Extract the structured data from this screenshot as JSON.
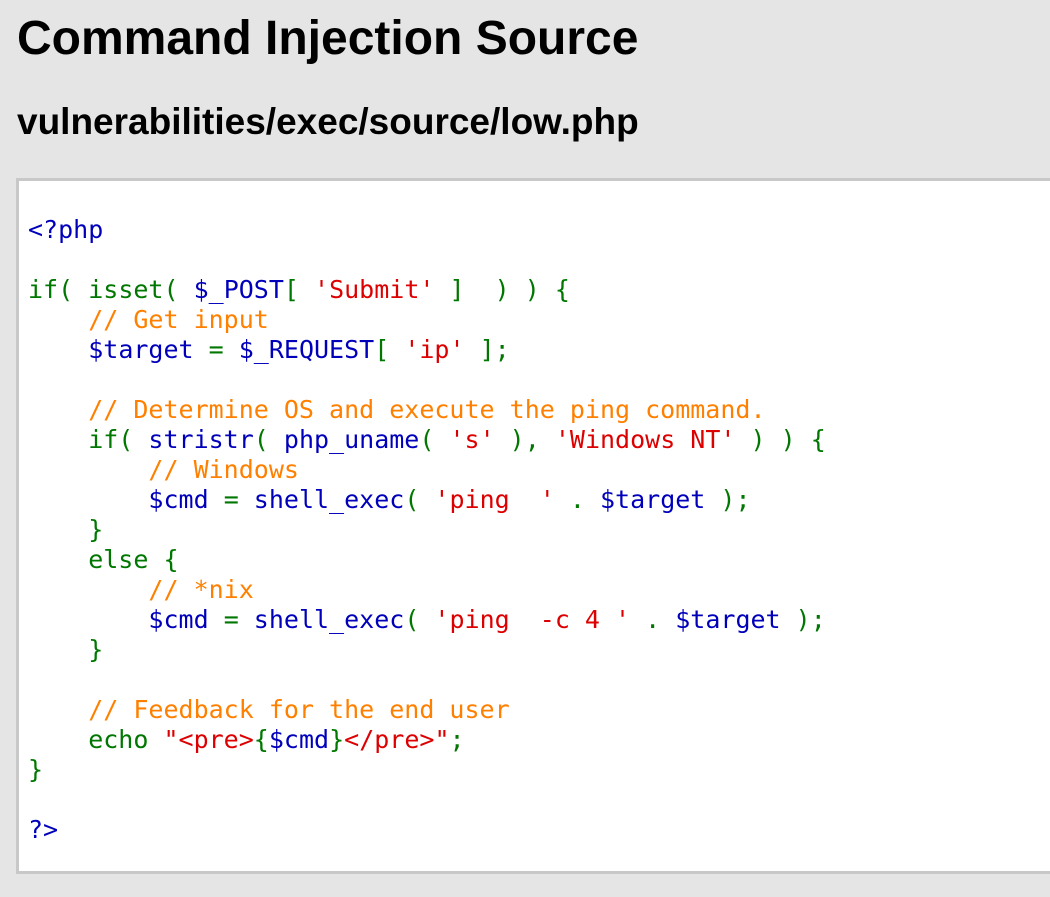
{
  "page": {
    "title": "Command Injection Source",
    "file_path": "vulnerabilities/exec/source/low.php"
  },
  "colors": {
    "background": "#e5e5e5",
    "code_background": "#ffffff",
    "code_border": "#c8c8c8",
    "keyword": "#007700",
    "default": "#0000bb",
    "string": "#dd0000",
    "comment": "#ff8000",
    "php_tag": "#0000bb"
  },
  "code": {
    "lines": [
      [
        {
          "t": "<?php",
          "c": "default"
        }
      ],
      [],
      [
        {
          "t": "if( ",
          "c": "keyword"
        },
        {
          "t": "isset",
          "c": "keyword"
        },
        {
          "t": "( ",
          "c": "keyword"
        },
        {
          "t": "$_POST",
          "c": "default"
        },
        {
          "t": "[ ",
          "c": "keyword"
        },
        {
          "t": "'Submit'",
          "c": "string"
        },
        {
          "t": " ]  ) ) {",
          "c": "keyword"
        }
      ],
      [
        {
          "t": "    // Get input",
          "c": "comment"
        }
      ],
      [
        {
          "t": "    ",
          "c": "keyword"
        },
        {
          "t": "$target ",
          "c": "default"
        },
        {
          "t": "= ",
          "c": "keyword"
        },
        {
          "t": "$_REQUEST",
          "c": "default"
        },
        {
          "t": "[ ",
          "c": "keyword"
        },
        {
          "t": "'ip'",
          "c": "string"
        },
        {
          "t": " ];",
          "c": "keyword"
        }
      ],
      [],
      [
        {
          "t": "    // Determine OS and execute the ping command.",
          "c": "comment"
        }
      ],
      [
        {
          "t": "    if( ",
          "c": "keyword"
        },
        {
          "t": "stristr",
          "c": "default"
        },
        {
          "t": "( ",
          "c": "keyword"
        },
        {
          "t": "php_uname",
          "c": "default"
        },
        {
          "t": "( ",
          "c": "keyword"
        },
        {
          "t": "'s'",
          "c": "string"
        },
        {
          "t": " ), ",
          "c": "keyword"
        },
        {
          "t": "'Windows NT'",
          "c": "string"
        },
        {
          "t": " ) ) {",
          "c": "keyword"
        }
      ],
      [
        {
          "t": "        // Windows",
          "c": "comment"
        }
      ],
      [
        {
          "t": "        ",
          "c": "keyword"
        },
        {
          "t": "$cmd ",
          "c": "default"
        },
        {
          "t": "= ",
          "c": "keyword"
        },
        {
          "t": "shell_exec",
          "c": "default"
        },
        {
          "t": "( ",
          "c": "keyword"
        },
        {
          "t": "'ping  '",
          "c": "string"
        },
        {
          "t": " . ",
          "c": "keyword"
        },
        {
          "t": "$target ",
          "c": "default"
        },
        {
          "t": ");",
          "c": "keyword"
        }
      ],
      [
        {
          "t": "    }",
          "c": "keyword"
        }
      ],
      [
        {
          "t": "    else {",
          "c": "keyword"
        }
      ],
      [
        {
          "t": "        // *nix",
          "c": "comment"
        }
      ],
      [
        {
          "t": "        ",
          "c": "keyword"
        },
        {
          "t": "$cmd ",
          "c": "default"
        },
        {
          "t": "= ",
          "c": "keyword"
        },
        {
          "t": "shell_exec",
          "c": "default"
        },
        {
          "t": "( ",
          "c": "keyword"
        },
        {
          "t": "'ping  -c 4 '",
          "c": "string"
        },
        {
          "t": " . ",
          "c": "keyword"
        },
        {
          "t": "$target ",
          "c": "default"
        },
        {
          "t": ");",
          "c": "keyword"
        }
      ],
      [
        {
          "t": "    }",
          "c": "keyword"
        }
      ],
      [],
      [
        {
          "t": "    // Feedback for the end user",
          "c": "comment"
        }
      ],
      [
        {
          "t": "    echo ",
          "c": "keyword"
        },
        {
          "t": "\"",
          "c": "string"
        },
        {
          "t": "<pre>",
          "c": "string"
        },
        {
          "t": "{",
          "c": "keyword"
        },
        {
          "t": "$cmd",
          "c": "default"
        },
        {
          "t": "}",
          "c": "keyword"
        },
        {
          "t": "</pre>",
          "c": "string"
        },
        {
          "t": "\"",
          "c": "string"
        },
        {
          "t": ";",
          "c": "keyword"
        }
      ],
      [
        {
          "t": "}",
          "c": "keyword"
        }
      ],
      [],
      [
        {
          "t": "?>",
          "c": "default"
        }
      ]
    ]
  }
}
